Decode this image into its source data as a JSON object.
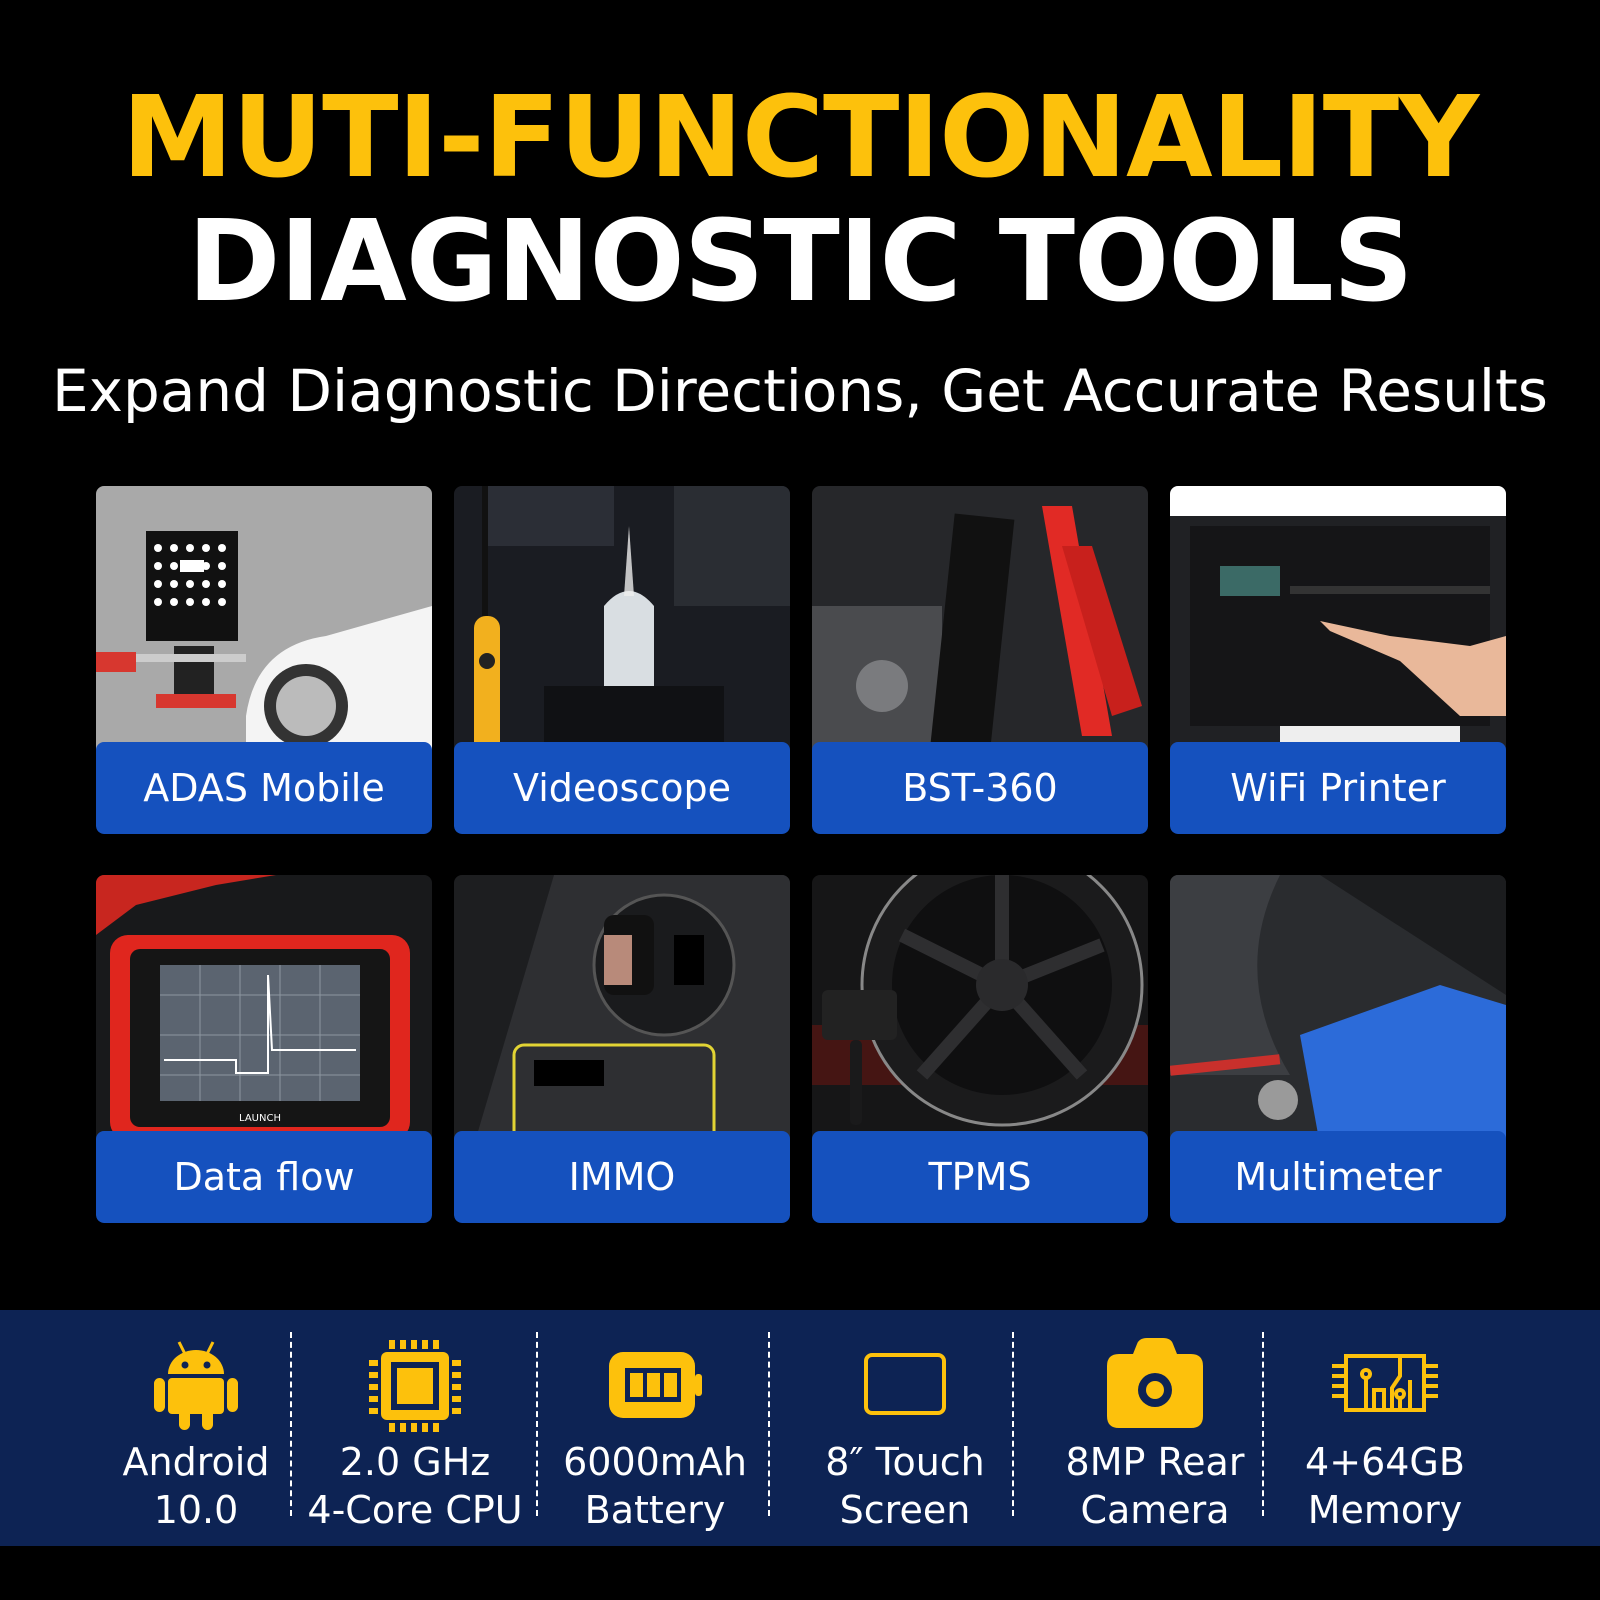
{
  "header": {
    "title_line1": "MUTI-FUNCTIONALITY",
    "title_line2": "DIAGNOSTIC TOOLS",
    "subtitle": "Expand Diagnostic Directions, Get Accurate Results"
  },
  "colors": {
    "accent_yellow": "#FDC10C",
    "label_blue": "#1551BE",
    "spec_bar_navy": "#0D2354",
    "background": "#000000"
  },
  "features": [
    {
      "label": "ADAS Mobile",
      "image": "adas-calibration-frame-photo"
    },
    {
      "label": "Videoscope",
      "image": "engine-bay-videoscope-photo"
    },
    {
      "label": "BST-360",
      "image": "battery-tester-clamps-photo"
    },
    {
      "label": "WiFi Printer",
      "image": "printer-photo"
    },
    {
      "label": "Data flow",
      "image": "launch-tablet-waveform-photo"
    },
    {
      "label": "IMMO",
      "image": "key-programmer-photo"
    },
    {
      "label": "TPMS",
      "image": "wheel-tpms-sensor-photo"
    },
    {
      "label": "Multimeter",
      "image": "battery-terminal-probe-photo"
    }
  ],
  "specs": [
    {
      "icon": "android-icon",
      "line1": "Android",
      "line2": "10.0"
    },
    {
      "icon": "cpu-chip-icon",
      "line1": "2.0 GHz",
      "line2": "4-Core CPU"
    },
    {
      "icon": "battery-icon",
      "line1": "6000mAh",
      "line2": "Battery"
    },
    {
      "icon": "touch-screen-icon",
      "line1": "8″ Touch",
      "line2": "Screen"
    },
    {
      "icon": "camera-icon",
      "line1": "8MP Rear",
      "line2": "Camera"
    },
    {
      "icon": "memory-chip-icon",
      "line1": "4+64GB",
      "line2": "Memory"
    }
  ]
}
